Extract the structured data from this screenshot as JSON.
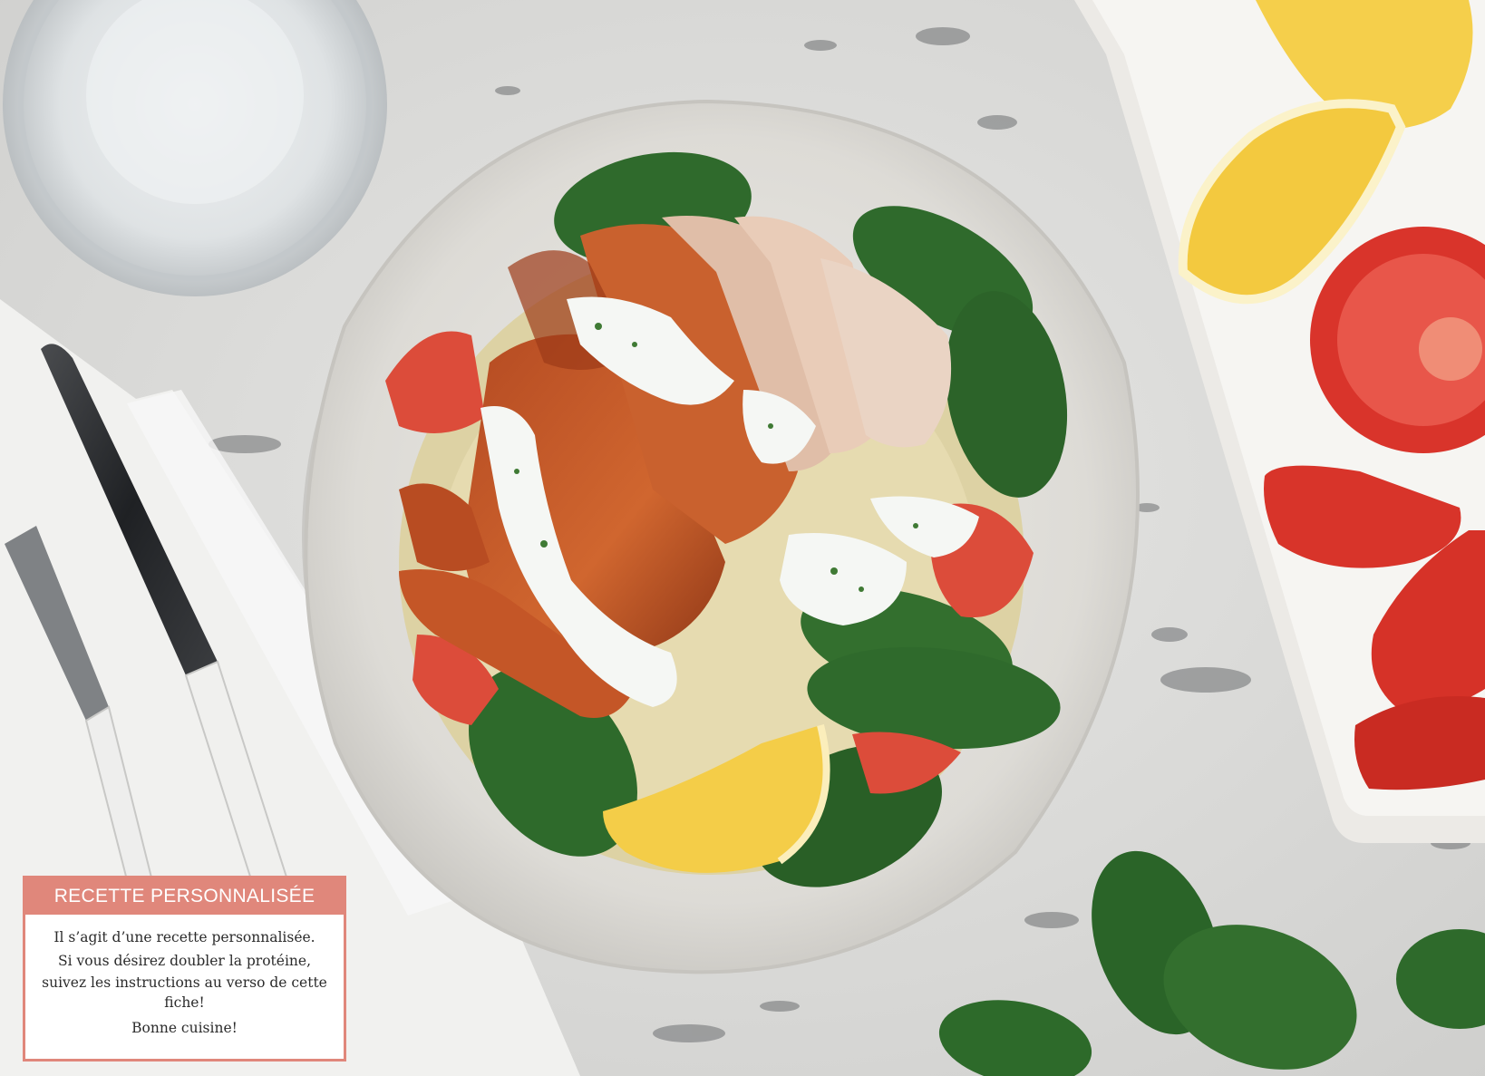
{
  "photo": {
    "subject": "chicken-bulgur-bowl",
    "colors": {
      "countertop": "#d9d9d7",
      "bowl": "#e4e2dd",
      "chicken": "#c9602e",
      "spinach": "#2f6a2c",
      "lemon": "#f3cc48",
      "tomato": "#d9362e",
      "sauce": "#f4f6f3",
      "napkin": "#f2f2f0"
    }
  },
  "card": {
    "title": "RECETTE PERSONNALISÉE",
    "line1": "Il s’agit d’une recette personnalisée.",
    "line2": "Si vous désirez doubler la protéine,",
    "line3": "suivez les instructions au verso de cette fiche!",
    "line4": "Bonne cuisine!",
    "accent": "#e0877b"
  }
}
